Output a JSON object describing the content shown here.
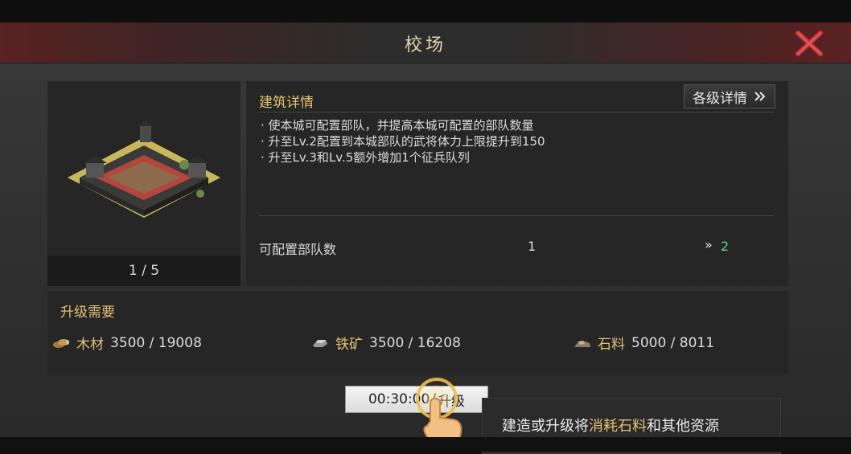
{
  "window": {
    "title": "校场"
  },
  "building": {
    "level_counter": "1 / 5"
  },
  "details": {
    "title": "建筑详情",
    "levels_button": "各级详情",
    "lines": [
      "· 使本城可配置部队，并提高本城可配置的部队数量",
      "· 升至Lv.2配置到本城部队的武将体力上限提升到150",
      "· 升至Lv.3和Lv.5额外增加1个征兵队列"
    ],
    "stat": {
      "label": "可配置部队数",
      "current": "1",
      "arrow": "»",
      "next": "2"
    }
  },
  "requirements": {
    "title": "升级需要",
    "items": [
      {
        "icon": "wood-icon",
        "name": "木材",
        "amount": "3500 / 19008"
      },
      {
        "icon": "iron-ore-icon",
        "name": "铁矿",
        "amount": "3500 / 16208"
      },
      {
        "icon": "stone-icon",
        "name": "石料",
        "amount": "5000 / 8011"
      }
    ]
  },
  "upgrade": {
    "time": "00:30:00",
    "divider": "/",
    "label": "升级"
  },
  "tooltip": {
    "prefix": "建造或升级将",
    "highlight": "消耗石料",
    "suffix": "和其他资源"
  },
  "colors": {
    "gold": "#e3c172",
    "green": "#5ed27e",
    "close_red": "#c8343a"
  }
}
